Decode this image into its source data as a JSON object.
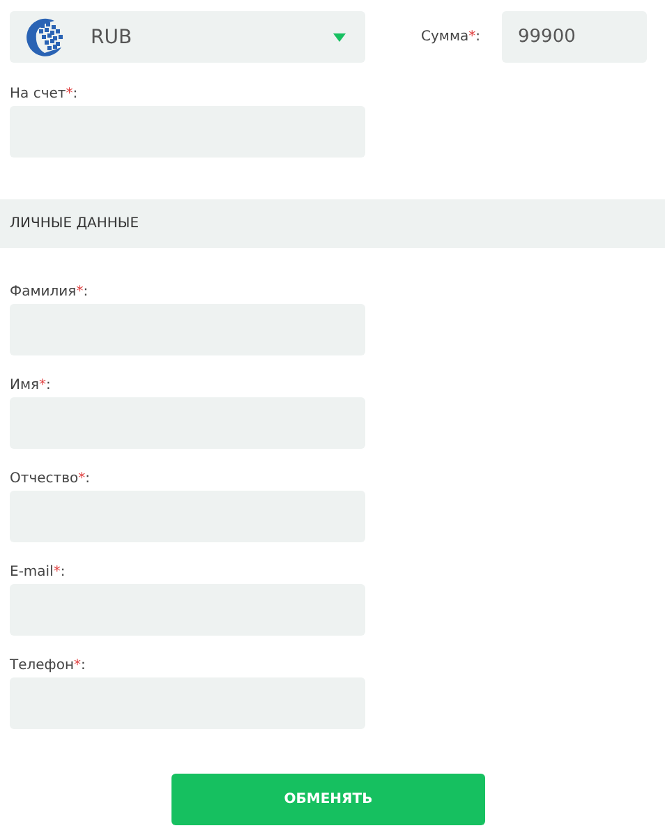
{
  "currency_select": {
    "value": "RUB"
  },
  "amount": {
    "label": "Сумма",
    "required_mark": "*",
    "label_end": ":",
    "value": "99900"
  },
  "account": {
    "label": "На счет",
    "required_mark": "*",
    "label_end": ":"
  },
  "section": {
    "title": "ЛИЧНЫЕ ДАННЫЕ"
  },
  "fields": [
    {
      "label": "Фамилия",
      "required_mark": "*",
      "label_end": ":"
    },
    {
      "label": "Имя",
      "required_mark": "*",
      "label_end": ":"
    },
    {
      "label": "Отчество",
      "required_mark": "*",
      "label_end": ":"
    },
    {
      "label": "E-mail",
      "required_mark": "*",
      "label_end": ":"
    },
    {
      "label": "Телефон",
      "required_mark": "*",
      "label_end": ":"
    }
  ],
  "submit_button": {
    "label": "ОБМЕНЯТЬ"
  }
}
